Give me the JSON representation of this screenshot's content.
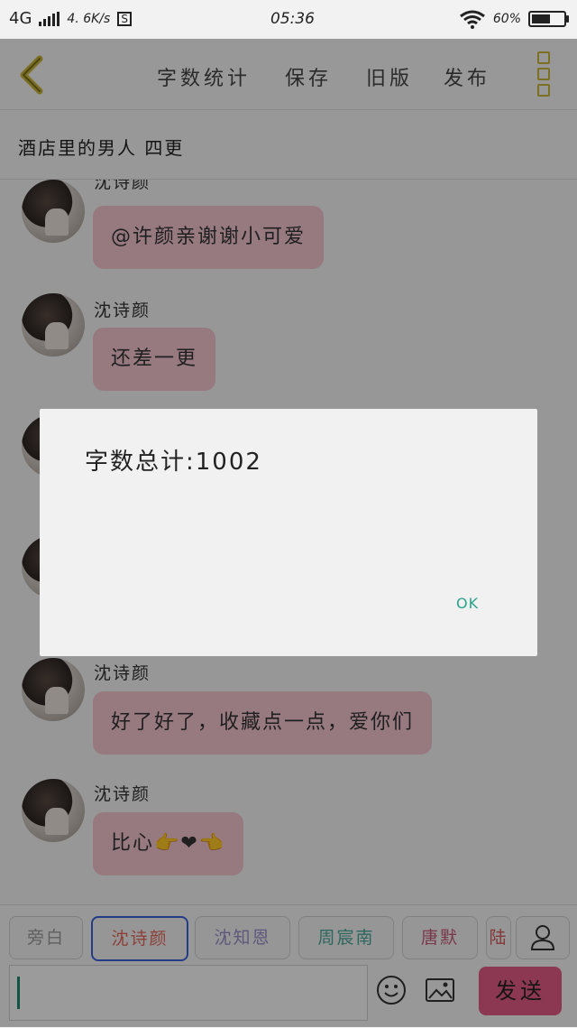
{
  "status": {
    "network": "4G",
    "speed": "4. 6K/s",
    "sim": "S",
    "time": "05:36",
    "battery": "60%",
    "battery_level": 0.6
  },
  "toolbar": {
    "menu": [
      "字数统计",
      "保存",
      "旧版",
      "发布"
    ]
  },
  "chapter": {
    "title": "酒店里的男人  四更"
  },
  "messages": [
    {
      "name": "沈诗颜",
      "text": "@许颜亲谢谢小可爱"
    },
    {
      "name": "沈诗颜",
      "text": "还差一更"
    },
    {
      "name": "沈诗颜",
      "text": "好了好了，收藏点一点，爱你们"
    },
    {
      "name": "沈诗颜",
      "text": "比心👉❤👈"
    }
  ],
  "characters": [
    {
      "label": "旁白",
      "color": "#9a9a9a"
    },
    {
      "label": "沈诗颜",
      "color": "#e06a5c"
    },
    {
      "label": "沈知恩",
      "color": "#9b8fc9"
    },
    {
      "label": "周宸南",
      "color": "#4aa796"
    },
    {
      "label": "唐默",
      "color": "#c65a7a"
    },
    {
      "label": "陆",
      "color": "#d45b5b"
    }
  ],
  "composer": {
    "send_label": "发送",
    "input_value": ""
  },
  "dialog": {
    "message": "字数总计:1002",
    "ok_label": "OK"
  }
}
